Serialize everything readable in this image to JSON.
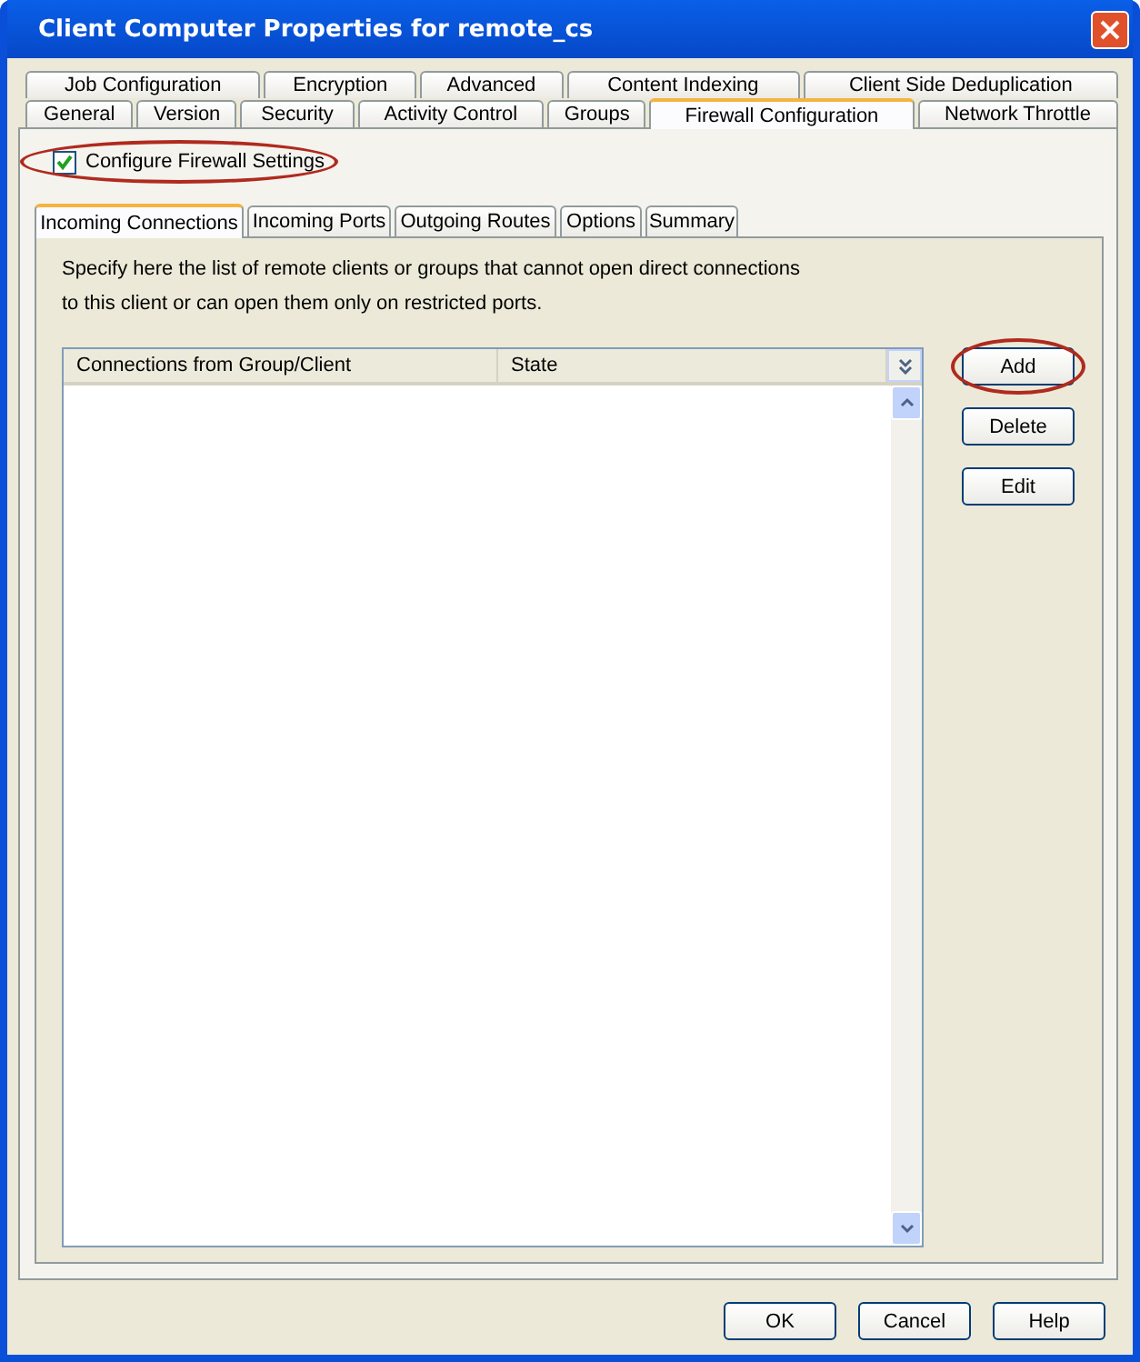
{
  "window": {
    "title": "Client Computer Properties for remote_cs"
  },
  "tab_rows": [
    [
      {
        "label": "Job Configuration",
        "selected": false
      },
      {
        "label": "Encryption",
        "selected": false
      },
      {
        "label": "Advanced",
        "selected": false
      },
      {
        "label": "Content Indexing",
        "selected": false
      },
      {
        "label": "Client Side Deduplication",
        "selected": false
      }
    ],
    [
      {
        "label": "General",
        "selected": false
      },
      {
        "label": "Version",
        "selected": false
      },
      {
        "label": "Security",
        "selected": false
      },
      {
        "label": "Activity Control",
        "selected": false
      },
      {
        "label": "Groups",
        "selected": false
      },
      {
        "label": "Firewall Configuration",
        "selected": true
      },
      {
        "label": "Network Throttle",
        "selected": false
      }
    ]
  ],
  "configure_checkbox": {
    "label": "Configure Firewall Settings",
    "checked": true,
    "highlighted": true
  },
  "inner_tabs": [
    {
      "label": "Incoming Connections",
      "selected": true
    },
    {
      "label": "Incoming Ports",
      "selected": false
    },
    {
      "label": "Outgoing Routes",
      "selected": false
    },
    {
      "label": "Options",
      "selected": false
    },
    {
      "label": "Summary",
      "selected": false
    }
  ],
  "description": "Specify here the list of remote clients or groups that cannot open direct connections\nto this client or can open them only on restricted ports.",
  "table": {
    "columns": [
      "Connections from Group/Client",
      "State"
    ]
  },
  "side_buttons": [
    {
      "label": "Add",
      "highlighted": true
    },
    {
      "label": "Delete",
      "highlighted": false
    },
    {
      "label": "Edit",
      "highlighted": false
    }
  ],
  "footer_buttons": [
    "OK",
    "Cancel",
    "Help"
  ]
}
